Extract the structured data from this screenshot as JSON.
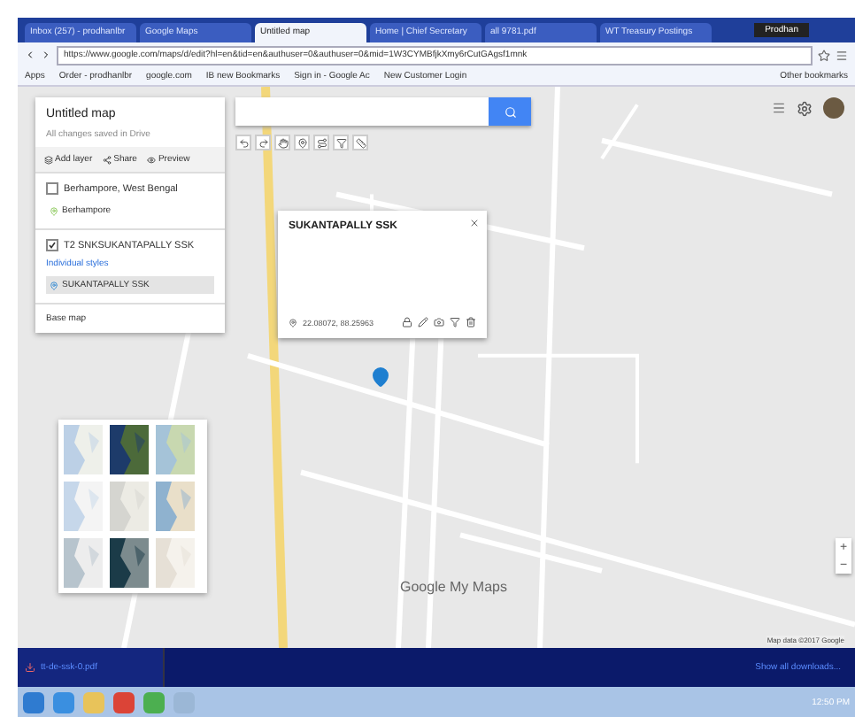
{
  "tabs": [
    {
      "label": "Inbox (257) - prodhanlbr",
      "selected": false
    },
    {
      "label": "Google Maps",
      "selected": false
    },
    {
      "label": "Untitled map",
      "selected": true
    },
    {
      "label": "Home | Chief Secretary",
      "selected": false
    },
    {
      "label": "all 9781.pdf",
      "selected": false
    },
    {
      "label": "WT Treasury Postings",
      "selected": false
    }
  ],
  "profile": "Prodhan",
  "address": "https://www.google.com/maps/d/edit?hl=en&tid=en&authuser=0&authuser=0&mid=1W3CYMBfjkXmy6rCutGAgsf1mnk",
  "bookmarks": [
    "Apps",
    "Order - prodhanlbr",
    "google.com",
    "IB new Bookmarks",
    "Sign in - Google Ac",
    "New Customer Login"
  ],
  "other_bookmarks": "Other bookmarks",
  "panel": {
    "title": "Untitled map",
    "subtitle": "All changes saved in Drive",
    "actions": [
      "Add layer",
      "Share",
      "Preview"
    ],
    "layers": [
      {
        "title": "Berhampore, West Bengal",
        "checked": false,
        "items": [
          {
            "label": "Berhampore",
            "selected": false
          }
        ]
      },
      {
        "title": "T2 SNKSUKANTAPALLY SSK",
        "checked": true,
        "style": "Individual styles",
        "items": [
          {
            "label": "SUKANTAPALLY SSK",
            "selected": true
          }
        ]
      }
    ],
    "base_map": "Base map"
  },
  "popup": {
    "title": "SUKANTAPALLY SSK",
    "coords": "22.08072, 88.25963"
  },
  "logo": "Google My Maps",
  "attribution": "Map data ©2017 Google",
  "zoom": [
    "+",
    "−"
  ],
  "download": {
    "file": "tt-de-ssk-0.pdf",
    "show_all": "Show all downloads..."
  },
  "clock": "12:50 PM"
}
